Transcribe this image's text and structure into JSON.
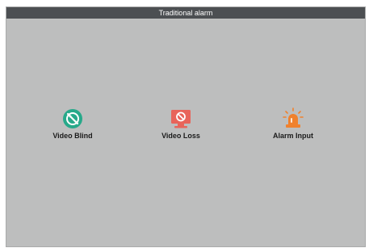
{
  "window": {
    "title": "Traditional alarm"
  },
  "tiles": [
    {
      "label": "Video Blind",
      "icon": "video-blind-icon",
      "color": "#27a98a"
    },
    {
      "label": "Video Loss",
      "icon": "video-loss-icon",
      "color": "#e8645a"
    },
    {
      "label": "Alarm Input",
      "icon": "alarm-input-icon",
      "color": "#f0812d"
    }
  ],
  "colors": {
    "titlebar": "#4c4f52",
    "panel": "#bdbebe"
  }
}
